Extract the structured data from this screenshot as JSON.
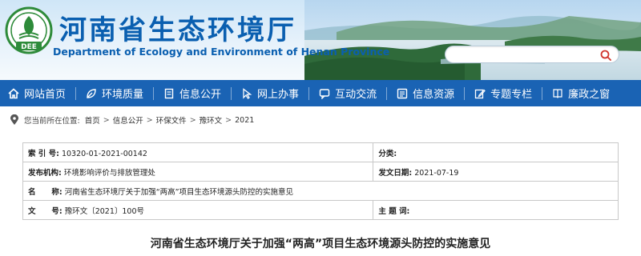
{
  "header": {
    "title_cn": "河南省生态环境厅",
    "title_en": "Department of Ecology and Environment of Henan Province",
    "logo_text": "DEE",
    "search_placeholder": ""
  },
  "nav": {
    "items": [
      {
        "label": "网站首页",
        "icon": "home-icon"
      },
      {
        "label": "环境质量",
        "icon": "leaf-icon"
      },
      {
        "label": "信息公开",
        "icon": "document-icon"
      },
      {
        "label": "网上办事",
        "icon": "cursor-icon"
      },
      {
        "label": "互动交流",
        "icon": "chat-icon"
      },
      {
        "label": "信息资源",
        "icon": "database-icon"
      },
      {
        "label": "专题专栏",
        "icon": "edit-icon"
      },
      {
        "label": "廉政之窗",
        "icon": "book-icon"
      }
    ]
  },
  "breadcrumb": {
    "prefix": "您当前所在位置:",
    "items": [
      "首页",
      "信息公开",
      "环保文件",
      "豫环文",
      "2021"
    ],
    "sep": ">"
  },
  "meta": {
    "index_label": "索 引 号:",
    "index_value": "10320-01-2021-00142",
    "category_label": "分类:",
    "category_value": "",
    "issuer_label": "发布机构:",
    "issuer_value": "环境影响评价与排放管理处",
    "date_label": "发文日期:",
    "date_value": "2021-07-19",
    "name_label": "名      称:",
    "name_value": "河南省生态环境厅关于加强“两高”项目生态环境源头防控的实施意见",
    "docno_label": "文      号:",
    "docno_value": "豫环文〔2021〕100号",
    "subject_label": "主 题 词:",
    "subject_value": ""
  },
  "document": {
    "title": "河南省生态环境厅关于加强“两高”项目生态环境源头防控的实施意见"
  },
  "colors": {
    "nav_bg": "#1a63b4",
    "title_blue": "#0a5fb0",
    "logo_green": "#2e8b3a"
  }
}
